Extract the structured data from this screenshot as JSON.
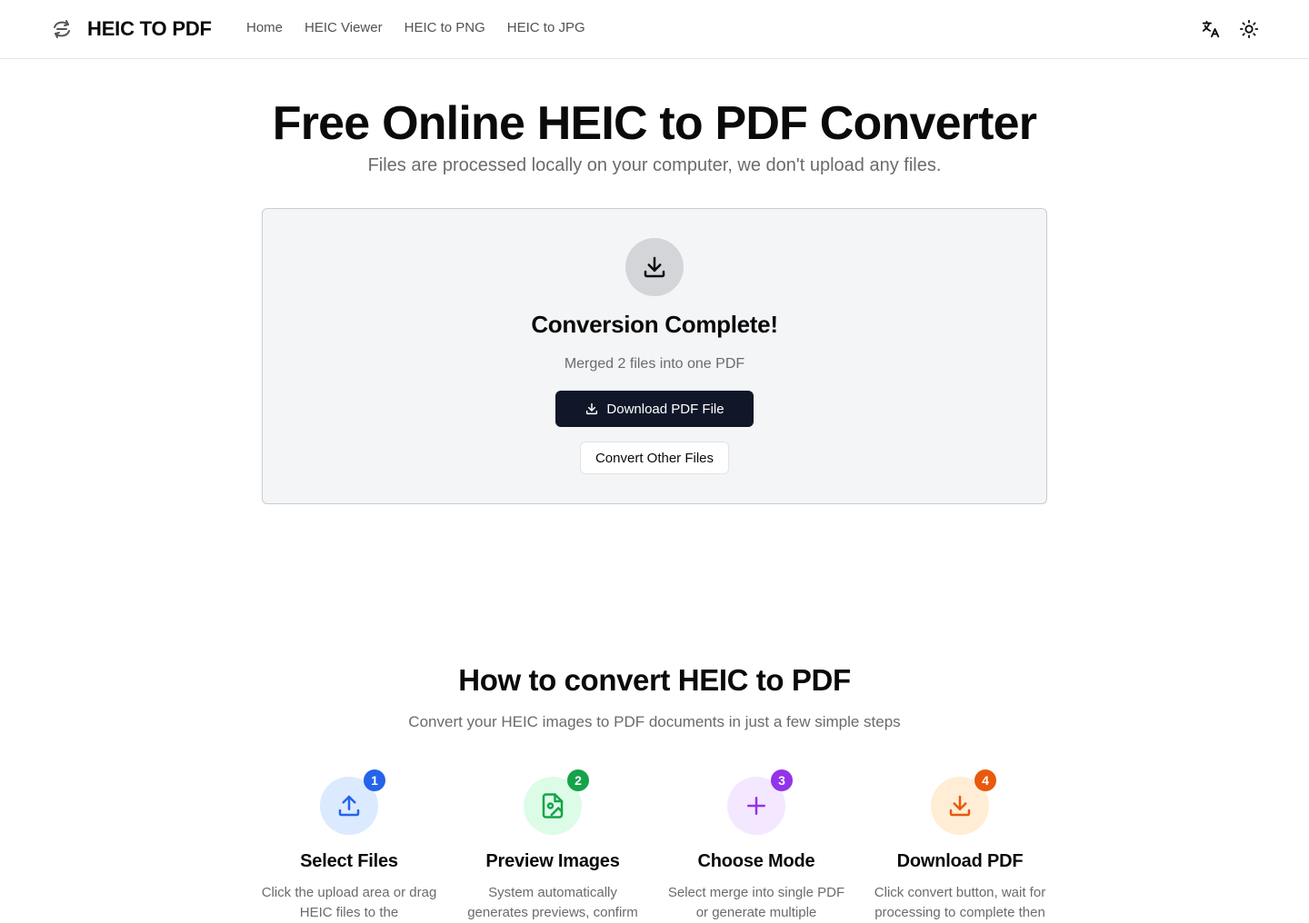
{
  "header": {
    "logo_text": "HEIC TO PDF",
    "logo_icon": "convert-arrows-icon",
    "nav": [
      {
        "label": "Home"
      },
      {
        "label": "HEIC Viewer"
      },
      {
        "label": "HEIC to PNG"
      },
      {
        "label": "HEIC to JPG"
      }
    ],
    "actions": [
      {
        "icon": "translate-icon"
      },
      {
        "icon": "sun-icon"
      }
    ]
  },
  "hero": {
    "title": "Free Online HEIC to PDF Converter",
    "subtitle": "Files are processed locally on your computer, we don't upload any files."
  },
  "result": {
    "icon": "download-icon",
    "title": "Conversion Complete!",
    "subtitle": "Merged 2 files into one PDF",
    "download_label": "Download PDF File",
    "convert_other_label": "Convert Other Files"
  },
  "howto": {
    "title": "How to convert HEIC to PDF",
    "subtitle": "Convert your HEIC images to PDF documents in just a few simple steps",
    "steps": [
      {
        "number": "1",
        "title": "Select Files",
        "desc": "Click the upload area or drag HEIC files to the",
        "icon": "upload-icon",
        "color": "#2563eb",
        "bg": "#dbeafe"
      },
      {
        "number": "2",
        "title": "Preview Images",
        "desc": "System automatically generates previews, confirm",
        "icon": "image-file-icon",
        "color": "#16a34a",
        "bg": "#dcfce7"
      },
      {
        "number": "3",
        "title": "Choose Mode",
        "desc": "Select merge into single PDF or generate multiple",
        "icon": "plus-icon",
        "color": "#9333ea",
        "bg": "#f3e8ff"
      },
      {
        "number": "4",
        "title": "Download PDF",
        "desc": "Click convert button, wait for processing to complete then",
        "icon": "download-icon",
        "color": "#ea580c",
        "bg": "#ffedd5"
      }
    ]
  }
}
